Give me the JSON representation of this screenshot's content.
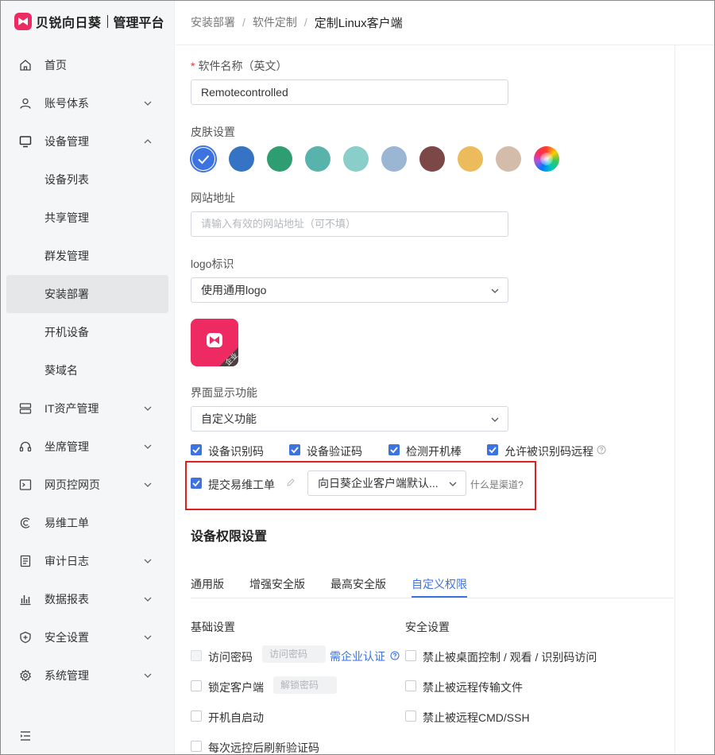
{
  "brand": {
    "name": "贝锐向日葵",
    "subtitle": "管理平台"
  },
  "sidebar": {
    "items": [
      {
        "label": "首页",
        "icon": "home-icon"
      },
      {
        "label": "账号体系",
        "icon": "user-icon"
      },
      {
        "label": "设备管理",
        "icon": "monitor-icon"
      },
      {
        "label": "设备列表"
      },
      {
        "label": "共享管理"
      },
      {
        "label": "群发管理"
      },
      {
        "label": "安装部署"
      },
      {
        "label": "开机设备"
      },
      {
        "label": "葵域名"
      },
      {
        "label": "IT资产管理",
        "icon": "server-icon"
      },
      {
        "label": "坐席管理",
        "icon": "headset-icon"
      },
      {
        "label": "网页控网页",
        "icon": "terminal-icon"
      },
      {
        "label": "易维工单",
        "icon": "ticket-icon"
      },
      {
        "label": "审计日志",
        "icon": "log-icon"
      },
      {
        "label": "数据报表",
        "icon": "chart-icon"
      },
      {
        "label": "安全设置",
        "icon": "shield-icon"
      },
      {
        "label": "系统管理",
        "icon": "gear-icon"
      }
    ]
  },
  "breadcrumb": {
    "item1": "安装部署",
    "item2": "软件定制",
    "current": "定制Linux客户端",
    "sep": "/"
  },
  "form": {
    "name_label": "软件名称（英文）",
    "name_value": "Remotecontrolled",
    "skin_label": "皮肤设置",
    "skin_colors": [
      "#3d73e0",
      "#3573c4",
      "#2e9e72",
      "#59b3ad",
      "#89cec8",
      "#9bb6d3",
      "#7b4747",
      "#ecbb5c",
      "#d4bcab"
    ],
    "website_label": "网站地址",
    "website_placeholder": "请输入有效的网站地址（可不填）",
    "logo_label": "logo标识",
    "logo_value": "使用通用logo",
    "logo_badge": "企业",
    "display_label": "界面显示功能",
    "display_value": "自定义功能",
    "features": {
      "f1": "设备识别码",
      "f2": "设备验证码",
      "f3": "检测开机棒",
      "f4": "允许被识别码远程"
    },
    "ticket_label": "提交易维工单",
    "channel_value": "向日葵企业客户端默认...",
    "channel_help": "什么是渠道?"
  },
  "perm": {
    "title": "设备权限设置",
    "tabs": [
      "通用版",
      "增强安全版",
      "最高安全版",
      "自定义权限"
    ],
    "basic_title": "基础设置",
    "security_title": "安全设置",
    "access_pw": "访问密码",
    "access_pw_placeholder": "访问密码",
    "need_auth": "需企业认证",
    "lock_client": "锁定客户端",
    "unlock_pw_placeholder": "解锁密码",
    "autostart": "开机自启动",
    "refresh_code": "每次远控后刷新验证码",
    "sec1": "禁止被桌面控制 / 观看 / 识别码访问",
    "sec2": "禁止被远程传输文件",
    "sec3": "禁止被远程CMD/SSH"
  }
}
